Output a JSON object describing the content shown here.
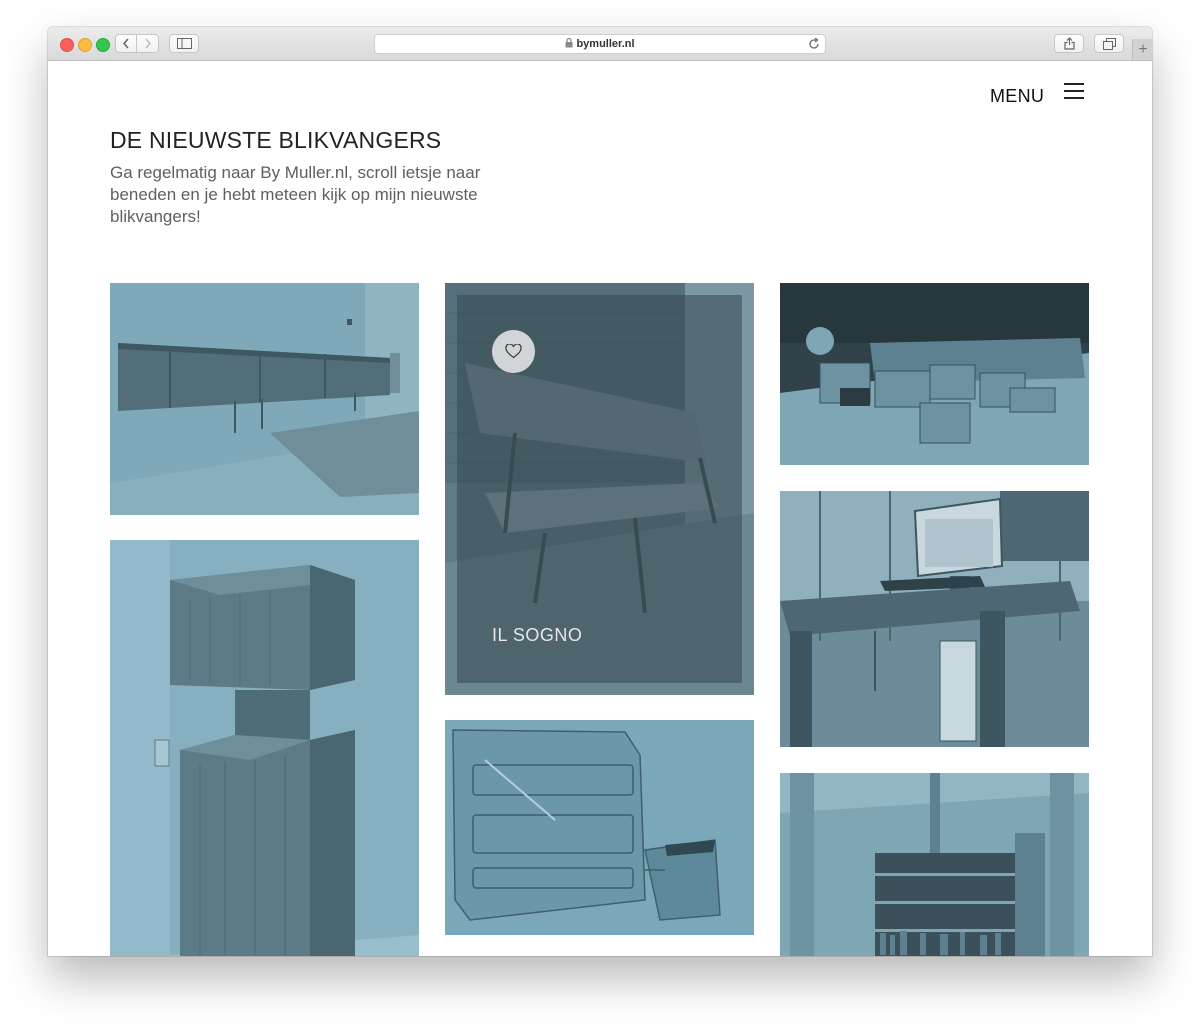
{
  "browser": {
    "url": "bymuller.nl"
  },
  "header": {
    "menu_label": "MENU"
  },
  "section": {
    "title": "DE NIEUWSTE BLIKVANGERS",
    "intro": "Ga regelmatig naar By Muller.nl, scroll ietsje naar beneden en je hebt meteen kijk op mijn nieuwste blikvangers!"
  },
  "gallery": {
    "featured_caption": "IL SOGNO"
  },
  "colors": {
    "tint": "#7aa5b5",
    "tint_dark": "#4b6a76",
    "overlay": "#374850"
  },
  "icons": [
    "back-icon",
    "forward-icon",
    "sidebar-icon",
    "lock-icon",
    "reload-icon",
    "share-icon",
    "tabs-icon",
    "plus-icon",
    "menu-icon",
    "heart-icon"
  ]
}
